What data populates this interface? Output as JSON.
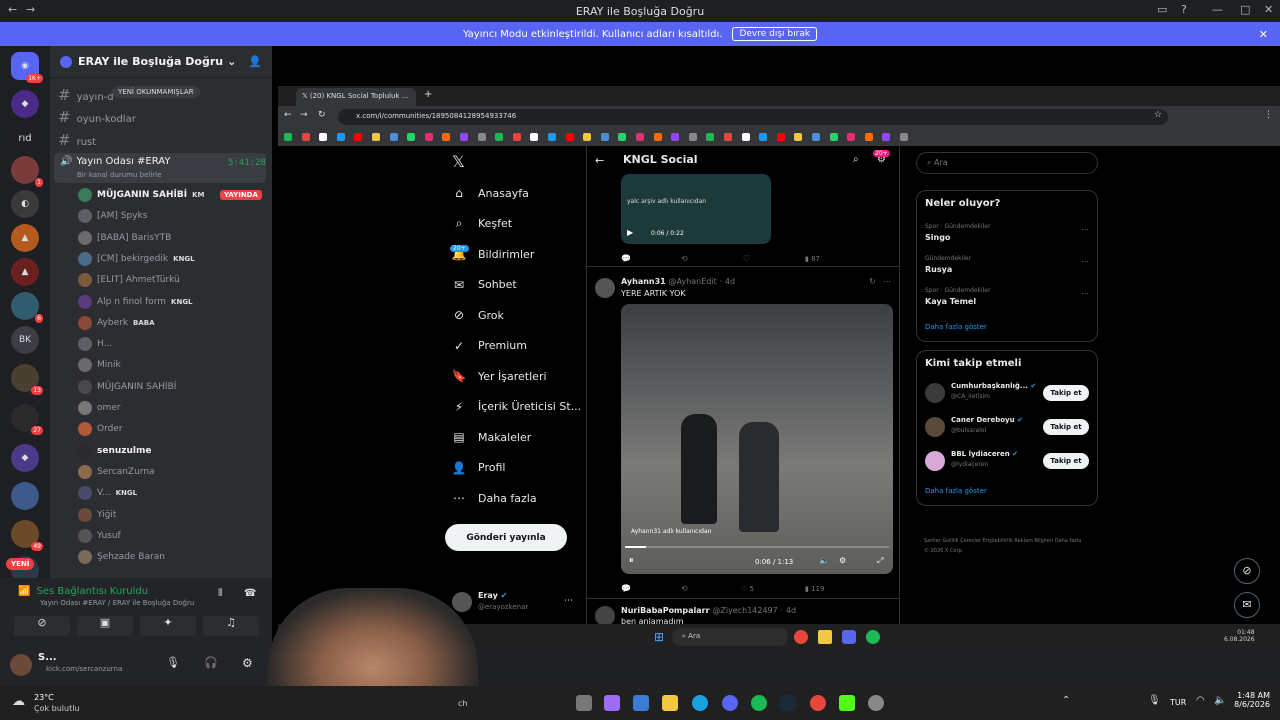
{
  "window": {
    "title": "ERAY ile Boşluğa Doğru"
  },
  "banner": {
    "text": "Yayıncı Modu etkinleştirildi. Kullanıcı adları kısaltıldı.",
    "button": "Devre dışı bırak"
  },
  "servers": {
    "rid": "rıd",
    "badges": [
      "1K+",
      "1",
      "6",
      "27",
      "13",
      "49",
      "0"
    ],
    "new_label": "YENİ"
  },
  "server": {
    "name": "ERAY ile Boşluğa Doğru"
  },
  "channels": {
    "items": [
      "yayın-d",
      "oyun-kodlar",
      "rust"
    ],
    "unread_pill": "YENİ OKUNMAMIŞLAR",
    "voice": {
      "name": "Yayın Odası #ERAY",
      "time": "5:41:28",
      "status": "Bir kanal durumu belirle"
    }
  },
  "members": [
    {
      "name": "MÜJGANIN SAHİBİ",
      "tag": "KM",
      "live": "YAYINDA"
    },
    {
      "name": "[AM] Spyks",
      "tag": ""
    },
    {
      "name": "[BABA] BarisYTB",
      "tag": ""
    },
    {
      "name": "[CM] bekirgedik",
      "tag": "KNGL"
    },
    {
      "name": "[ELIT] AhmetTürkü",
      "tag": ""
    },
    {
      "name": "Alp n finol form",
      "tag": "KNGL"
    },
    {
      "name": "Ayberk",
      "tag": "BABA"
    },
    {
      "name": "H...",
      "tag": ""
    },
    {
      "name": "Minik",
      "tag": ""
    },
    {
      "name": "MÜJGANIN SAHİBİ",
      "tag": ""
    },
    {
      "name": "omer",
      "tag": ""
    },
    {
      "name": "Order",
      "tag": ""
    },
    {
      "name": "senuzulme",
      "tag": ""
    },
    {
      "name": "SercanZurna",
      "tag": ""
    },
    {
      "name": "V...",
      "tag": "KNGL"
    },
    {
      "name": "Yiğit",
      "tag": ""
    },
    {
      "name": "Yusuf",
      "tag": ""
    },
    {
      "name": "Şehzade Baran",
      "tag": ""
    }
  ],
  "voice_panel": {
    "status": "Ses Bağlantısı Kuruldu",
    "channel": "Yayın Odası #ERAY / ERAY ile Boşluğa Doğru",
    "user": "S...",
    "user_sub": "kick.com/sercanzurna"
  },
  "browser": {
    "tab_title": "(20) KNGL Social Topluluk ...",
    "url": "x.com/i/communities/1895084128954933746"
  },
  "x_nav": {
    "items": [
      "Anasayfa",
      "Keşfet",
      "Bildirimler",
      "Sohbet",
      "Grok",
      "Premium",
      "Yer İşaretleri",
      "İçerik Üreticisi St...",
      "Makaleler",
      "Profil",
      "Daha fazla"
    ],
    "notif_badge": "20+",
    "post_button": "Gönderi yayınla",
    "account_name": "Eray",
    "account_handle": "@erayozkenar"
  },
  "feed": {
    "title": "KNGL Social",
    "badge": "20+",
    "top_video": {
      "attribution": "yalc arşiv adlı kullanıcıdan",
      "time": "0:06 / 0:22",
      "views": "87"
    },
    "post": {
      "author": "Ayhann31",
      "handle": "@AyhanEdit",
      "age": "4d",
      "text": "YERE ARTIK YOK",
      "attribution": "Ayhann31 adlı kullanıcıdan",
      "time": "0:06 / 1:13",
      "likes": "5",
      "views": "119"
    },
    "next_post": {
      "author": "NuriBabaPompalarr",
      "handle": "@Ziyech142497",
      "age": "4d",
      "text": "ben anlamadım"
    }
  },
  "sidebar": {
    "search_placeholder": "Ara",
    "trends_title": "Neler oluyor?",
    "trends": [
      {
        "category": "Spor · Gündemdekiler",
        "name": "Singo"
      },
      {
        "category": "Gündemdekiler",
        "name": "Rusya"
      },
      {
        "category": "Spor · Gündemdekiler",
        "name": "Kaya Temel"
      }
    ],
    "show_more": "Daha fazla göster",
    "who_title": "Kimi takip etmeli",
    "who": [
      {
        "name": "Cumhurbaşkanlığ...",
        "handle": "@CA_iletisim"
      },
      {
        "name": "Caner Dereboyu",
        "handle": "@bulsaralol"
      },
      {
        "name": "BBL lydiaceren",
        "handle": "@lydiaceren"
      }
    ],
    "follow_label": "Takip et",
    "footer": "Şartlar   Gizlilik   Çerezler   Erişilebilirlik   Reklam Bilgileri   Daha fazla   © 2026 X Corp."
  },
  "inner_taskbar": {
    "search": "Ara",
    "time": "01:48",
    "date": "6.08.2026"
  },
  "taskbar": {
    "weather_temp": "23°C",
    "weather_text": "Çok bulutlu",
    "search": "ch",
    "lang": "TUR",
    "time": "1:48 AM",
    "date": "8/6/2026"
  }
}
